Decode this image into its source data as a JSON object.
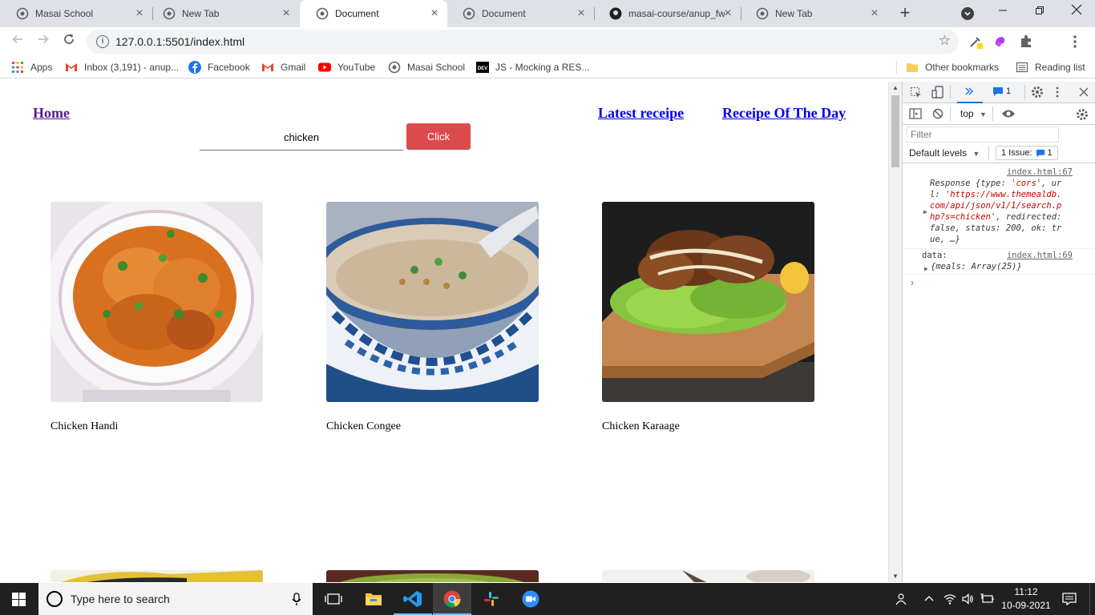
{
  "tabs": [
    {
      "title": "Masai School",
      "active": false
    },
    {
      "title": "New Tab",
      "active": false
    },
    {
      "title": "Document",
      "active": true
    },
    {
      "title": "Document",
      "active": false
    },
    {
      "title": "masai-course/anup_fw",
      "active": false
    },
    {
      "title": "New Tab",
      "active": false
    }
  ],
  "toolbar": {
    "url": "127.0.0.1:5501/index.html"
  },
  "bookmarks": {
    "apps": "Apps",
    "inbox": "Inbox (3,191) - anup...",
    "facebook": "Facebook",
    "gmail": "Gmail",
    "youtube": "YouTube",
    "masai": "Masai School",
    "js": "JS - Mocking a RES...",
    "other": "Other bookmarks",
    "reading": "Reading list"
  },
  "page": {
    "nav_home": "Home",
    "nav_latest": "Latest receipe",
    "nav_day": "Receipe Of The Day",
    "search_value": "chicken",
    "search_button": "Click",
    "recipes": [
      {
        "name": "Chicken Handi"
      },
      {
        "name": "Chicken Congee"
      },
      {
        "name": "Chicken Karaage"
      }
    ]
  },
  "devtools": {
    "badge_count": "1",
    "context": "top",
    "filter_placeholder": "Filter",
    "levels": "Default levels",
    "issues": "1 Issue:",
    "issues_count": "1",
    "entry1_src": "index.html:67",
    "entry1_label": "Response {",
    "entry1_type_key": "type: ",
    "entry1_type_val": "'cors'",
    "entry1_url_key": ", ur",
    "entry1_url_line2a": "l: ",
    "entry1_url_val1": "'https://www.themealdb.",
    "entry1_url_val2": "com/api/json/v1/1/search.p",
    "entry1_url_val3": "hp?s=chicken'",
    "entry1_redirected": ", redirected:",
    "entry1_line5": "false, status: 200, ok: tr",
    "entry1_line6": "ue, …}",
    "entry2_src": "index.html:69",
    "entry2_label": "data:",
    "entry2_obj": "{meals: Array(25)}"
  },
  "taskbar": {
    "search_placeholder": "Type here to search",
    "time": "11:12",
    "date": "10-09-2021"
  },
  "colors": {
    "accent_button": "#dc4c4c",
    "link_visited": "#551a8b",
    "link": "#0000ee"
  }
}
